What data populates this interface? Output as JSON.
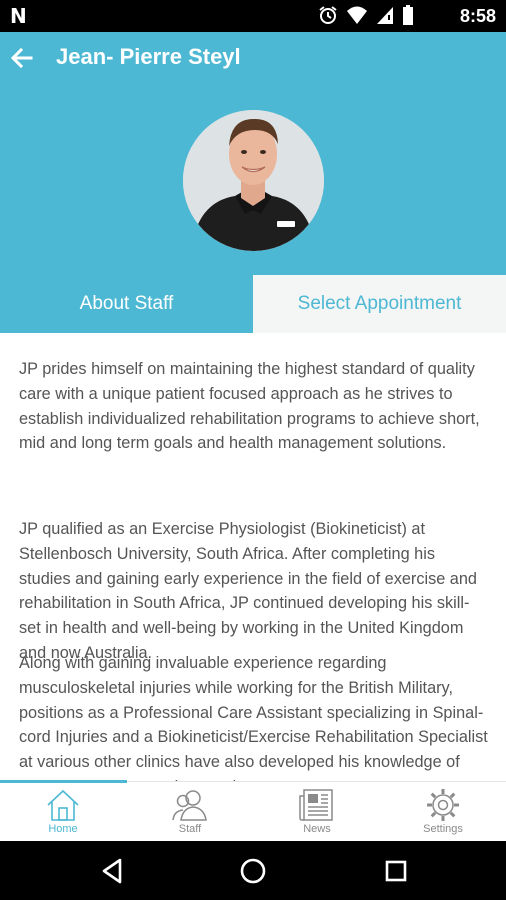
{
  "status_bar": {
    "notification_icon": "N",
    "icons": [
      "alarm-icon",
      "wifi-icon",
      "signal-icon",
      "battery-icon"
    ],
    "time": "8:58"
  },
  "header": {
    "back_icon": "arrow-left-icon",
    "title": "Jean- Pierre Steyl"
  },
  "tabs": [
    {
      "label": "About Staff",
      "active": true
    },
    {
      "label": "Select Appointment",
      "active": false
    }
  ],
  "about": {
    "paragraphs": [
      "JP prides himself on maintaining the highest standard of quality care with a unique patient focused approach as he strives to establish individualized rehabilitation programs to achieve short, mid and long term goals and health management solutions.",
      "JP qualified as an Exercise Physiologist (Biokineticist) at Stellenbosch University, South Africa. After completing his studies and gaining early experience in the field of exercise and rehabilitation in South Africa, JP continued developing his skill-set in health and well-being by working in the United Kingdom and now Australia.",
      "Along with gaining invaluable experience regarding musculoskeletal injuries while working for the British Military, positions as a Professional Care Assistant specializing in Spinal-cord Injuries and a Biokineticist/Exercise Rehabilitation Specialist at various other clinics have also developed his knowledge of many injury presentations and"
    ]
  },
  "bottom_nav": [
    {
      "label": "Home",
      "icon": "home-icon",
      "active": true
    },
    {
      "label": "Staff",
      "icon": "staff-icon",
      "active": false
    },
    {
      "label": "News",
      "icon": "news-icon",
      "active": false
    },
    {
      "label": "Settings",
      "icon": "gear-icon",
      "active": false
    }
  ],
  "colors": {
    "accent": "#4db8d3",
    "tab_inactive_bg": "#f4f5f5",
    "body_text": "#555555"
  }
}
